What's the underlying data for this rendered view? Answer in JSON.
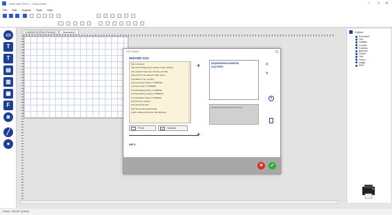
{
  "window": {
    "title": "NiceLabel 2019 — Document1",
    "min": "–",
    "max": "□",
    "close": "✕"
  },
  "menu": [
    "File",
    "Edit",
    "Objects",
    "Tools",
    "Help"
  ],
  "doc_tabs": [
    "Untitled2.lbl [Print Preview]",
    "Document1"
  ],
  "right_panel": {
    "title": "Objects",
    "items": [
      "Document",
      "Text",
      "Variable",
      "Counter",
      "Function",
      "Barcode",
      "Picture",
      "Line",
      "Frame",
      "Image",
      "RFID"
    ]
  },
  "status": "Printer: 300 DPI (100%)",
  "dialog": {
    "title": "GS1 Wizard",
    "heading": "WIZARD GS1",
    "ai_list": [
      "(01) Unknown",
      "(00) Serial Shipping Container Code (SSCC)",
      "(01) Global Trade Item Number (GTIN)",
      "(02) GTIN of Contained Trade Items",
      "(10) Batch or lot number",
      "(11) Production Date (YYMMDD)",
      "(12) Due Date (YYMMDD)",
      "(13) Packaging Date (YYMMDD)",
      "(15) Best Before Date (YYMMDD)",
      "(17) Expiration Date (YYMMDD)",
      "(20) Product variant",
      "(21) Serial Number",
      "(22) Secondary Data Fields",
      "(240) Additional Product Identification"
    ],
    "result_lines": [
      "(00)000000000123456789",
      "(12)170522"
    ],
    "preview_text": "0000000000123456789120170522",
    "fixed_label": "Fixed",
    "variable_label": "Variable",
    "info_label": "INFO"
  }
}
